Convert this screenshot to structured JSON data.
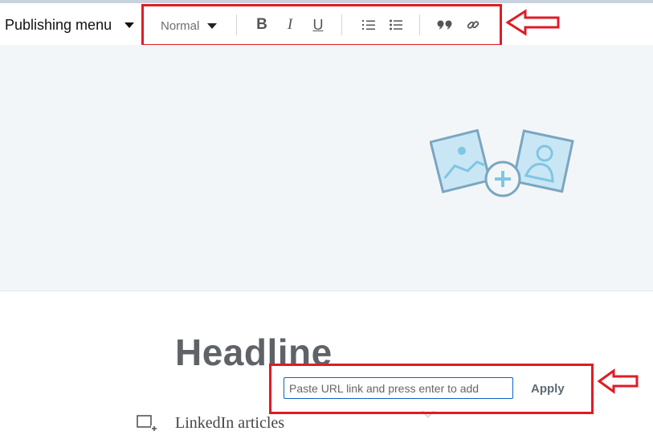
{
  "toolbar": {
    "publishing_menu_label": "Publishing menu",
    "text_style_value": "Normal",
    "bold_label": "B",
    "italic_label": "I",
    "underline_label": "U",
    "ordered_list_icon": "ordered-list-icon",
    "bullet_list_icon": "bullet-list-icon",
    "quote_icon": "quote-icon",
    "link_icon": "link-icon"
  },
  "cover": {
    "upload_icon": "add-image-icon"
  },
  "article": {
    "headline": "Headline",
    "body_text": "LinkedIn articles"
  },
  "url_popup": {
    "placeholder": "Paste URL link and press enter to add",
    "apply_label": "Apply"
  },
  "annotations": {
    "highlight_color": "#e01b24"
  }
}
